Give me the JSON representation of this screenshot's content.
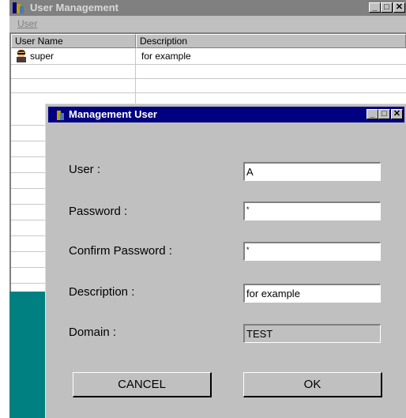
{
  "parent_window": {
    "title": "User Management",
    "menu": {
      "user_label": "User"
    },
    "columns": [
      "User Name",
      "Description"
    ],
    "rows": [
      {
        "name": "super",
        "description": "for example",
        "icon": "user-avatar-icon"
      }
    ]
  },
  "dialog": {
    "title": "Management User",
    "fields": {
      "user": {
        "label": "User :",
        "value": "A"
      },
      "password": {
        "label": "Password :",
        "value": "*"
      },
      "confirm_password": {
        "label": "Confirm Password :",
        "value": "*"
      },
      "description": {
        "label": "Description :",
        "value": "for example"
      },
      "domain": {
        "label": "Domain :",
        "value": "TEST"
      }
    },
    "buttons": {
      "cancel": "CANCEL",
      "ok": "OK"
    }
  },
  "window_controls": {
    "minimize": "_",
    "maximize": "□",
    "close": "✕"
  },
  "colors": {
    "dialog_title_bar": "#000080",
    "inactive_title_bar": "#808080",
    "desktop": "#008080",
    "window_face": "#c0c0c0"
  }
}
